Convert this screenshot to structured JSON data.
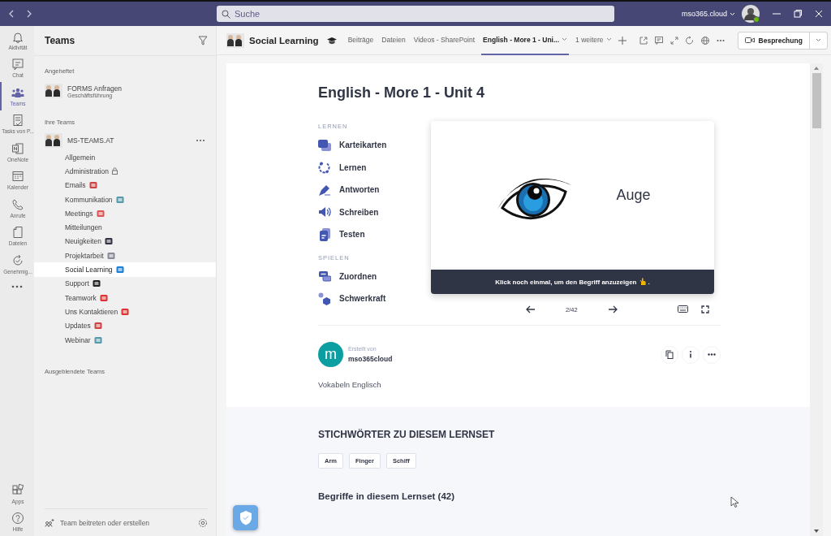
{
  "titlebar": {
    "search": {
      "placeholder": "Suche"
    },
    "account": "mso365.cloud"
  },
  "rail": {
    "items": [
      {
        "label": "Aktivität",
        "kind": "bell",
        "selected": false
      },
      {
        "label": "Chat",
        "kind": "chat",
        "selected": false
      },
      {
        "label": "Teams",
        "kind": "teams",
        "selected": true
      },
      {
        "label": "Tasks von P...",
        "kind": "tasks",
        "selected": false
      },
      {
        "label": "OneNote",
        "kind": "note",
        "selected": false
      },
      {
        "label": "Kalender",
        "kind": "calendar",
        "selected": false
      },
      {
        "label": "Anrufe",
        "kind": "phone",
        "selected": false
      },
      {
        "label": "Dateien",
        "kind": "file",
        "selected": false
      },
      {
        "label": "Genehmig...",
        "kind": "approve",
        "selected": false
      }
    ],
    "bottom_items": [
      {
        "label": "Apps",
        "kind": "apps",
        "selected": false
      },
      {
        "label": "Hilfe",
        "kind": "help",
        "selected": false
      }
    ]
  },
  "sidebar": {
    "title": "Teams",
    "pinned": {
      "heading": "Angeheftet",
      "teams": [
        {
          "name": "FORMS Anfragen",
          "subtitle": "Geschäftsführung"
        }
      ]
    },
    "your_teams": {
      "heading": "Ihre Teams",
      "teams": [
        {
          "name": "MS-TEAMS.AT",
          "channels": [
            {
              "name": "Allgemein",
              "selected": false,
              "locked": false,
              "emoji": false
            },
            {
              "name": "Administration",
              "selected": false,
              "locked": true,
              "emoji": false
            },
            {
              "name": "Emails",
              "selected": false,
              "locked": false,
              "emoji": true
            },
            {
              "name": "Kommunikation",
              "selected": false,
              "locked": false,
              "emoji": true
            },
            {
              "name": "Meetings",
              "selected": false,
              "locked": false,
              "emoji": true
            },
            {
              "name": "Mitteilungen",
              "selected": false,
              "locked": false,
              "emoji": false
            },
            {
              "name": "Neuigkeiten",
              "selected": false,
              "locked": false,
              "emoji": true
            },
            {
              "name": "Projektarbeit",
              "selected": false,
              "locked": false,
              "emoji": true
            },
            {
              "name": "Social Learning",
              "selected": true,
              "locked": false,
              "emoji": true
            },
            {
              "name": "Support",
              "selected": false,
              "locked": false,
              "emoji": true
            },
            {
              "name": "Teamwork",
              "selected": false,
              "locked": false,
              "emoji": true
            },
            {
              "name": "Uns Kontaktieren",
              "selected": false,
              "locked": false,
              "emoji": true
            },
            {
              "name": "Updates",
              "selected": false,
              "locked": false,
              "emoji": true
            },
            {
              "name": "Webinar",
              "selected": false,
              "locked": false,
              "emoji": true
            }
          ]
        }
      ]
    },
    "hidden_heading": "Ausgeblendete Teams",
    "footer": "Team beitreten oder erstellen"
  },
  "header": {
    "title": "Social Learning",
    "tabs": [
      {
        "label": "Beiträge",
        "selected": false,
        "dropdown": false
      },
      {
        "label": "Dateien",
        "selected": false,
        "dropdown": false
      },
      {
        "label": "Videos - SharePoint",
        "selected": false,
        "dropdown": false
      },
      {
        "label": "English - More 1 - Uni...",
        "selected": true,
        "dropdown": true
      },
      {
        "label": "1 weitere",
        "selected": false,
        "dropdown": true
      }
    ],
    "meeting_button": "Besprechung"
  },
  "study": {
    "title": "English - More 1 - Unit 4",
    "menu_sections": [
      {
        "heading": "LERNEN",
        "items": [
          {
            "label": "Karteikarten",
            "kind": "cards"
          },
          {
            "label": "Lernen",
            "kind": "learn"
          },
          {
            "label": "Antworten",
            "kind": "write"
          },
          {
            "label": "Schreiben",
            "kind": "speak"
          },
          {
            "label": "Testen",
            "kind": "test"
          }
        ]
      },
      {
        "heading": "SPIELEN",
        "items": [
          {
            "label": "Zuordnen",
            "kind": "match"
          },
          {
            "label": "Schwerkraft",
            "kind": "gravity"
          }
        ]
      }
    ],
    "flashcard": {
      "term": "Auge",
      "hint": "Klick noch einmal, um den Begriff anzuzeigen",
      "hint_end": "."
    },
    "counter": "2/42",
    "creator": {
      "label": "Erstellt von",
      "name": "mso365cloud",
      "initial": "m"
    },
    "description": "Vokabeln Englisch",
    "tags_heading": "STICHWÖRTER ZU DIESEM LERNSET",
    "tags": [
      "Arm",
      "Finger",
      "Schiff"
    ],
    "terms_heading": "Begriffe in diesem Lernset (42)"
  }
}
